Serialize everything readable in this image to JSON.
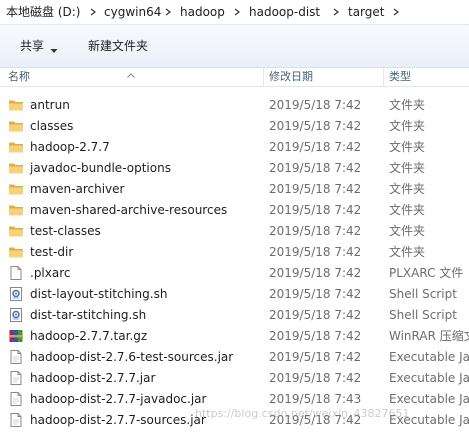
{
  "address_bar": {
    "crumbs": [
      "本地磁盘 (D:)",
      "cygwin64",
      "hadoop",
      "hadoop-dist",
      "target"
    ]
  },
  "toolbar": {
    "share_label": "共享",
    "new_folder_label": "新建文件夹"
  },
  "columns": {
    "name": "名称",
    "date": "修改日期",
    "type": "类型"
  },
  "files": [
    {
      "name": "antrun",
      "date": "2019/5/18 7:42",
      "type": "文件夹",
      "icon": "folder"
    },
    {
      "name": "classes",
      "date": "2019/5/18 7:42",
      "type": "文件夹",
      "icon": "folder"
    },
    {
      "name": "hadoop-2.7.7",
      "date": "2019/5/18 7:42",
      "type": "文件夹",
      "icon": "folder"
    },
    {
      "name": "javadoc-bundle-options",
      "date": "2019/5/18 7:42",
      "type": "文件夹",
      "icon": "folder"
    },
    {
      "name": "maven-archiver",
      "date": "2019/5/18 7:42",
      "type": "文件夹",
      "icon": "folder"
    },
    {
      "name": "maven-shared-archive-resources",
      "date": "2019/5/18 7:42",
      "type": "文件夹",
      "icon": "folder"
    },
    {
      "name": "test-classes",
      "date": "2019/5/18 7:42",
      "type": "文件夹",
      "icon": "folder"
    },
    {
      "name": "test-dir",
      "date": "2019/5/18 7:42",
      "type": "文件夹",
      "icon": "folder"
    },
    {
      "name": ".plxarc",
      "date": "2019/5/18 7:42",
      "type": "PLXARC 文件",
      "icon": "file"
    },
    {
      "name": "dist-layout-stitching.sh",
      "date": "2019/5/18 7:42",
      "type": "Shell Script",
      "icon": "script"
    },
    {
      "name": "dist-tar-stitching.sh",
      "date": "2019/5/18 7:42",
      "type": "Shell Script",
      "icon": "script"
    },
    {
      "name": "hadoop-2.7.7.tar.gz",
      "date": "2019/5/18 7:42",
      "type": "WinRAR 压缩文件",
      "icon": "archive"
    },
    {
      "name": "hadoop-dist-2.7.6-test-sources.jar",
      "date": "2019/5/18 7:42",
      "type": "Executable Jar File",
      "icon": "jar"
    },
    {
      "name": "hadoop-dist-2.7.7.jar",
      "date": "2019/5/18 7:42",
      "type": "Executable Jar File",
      "icon": "jar"
    },
    {
      "name": "hadoop-dist-2.7.7-javadoc.jar",
      "date": "2019/5/18 7:43",
      "type": "Executable Jar File",
      "icon": "jar"
    },
    {
      "name": "hadoop-dist-2.7.7-sources.jar",
      "date": "2019/5/18 7:42",
      "type": "Executable Jar File",
      "icon": "jar"
    }
  ],
  "watermark": "https://blog.csdn.net/weixin_43827651"
}
